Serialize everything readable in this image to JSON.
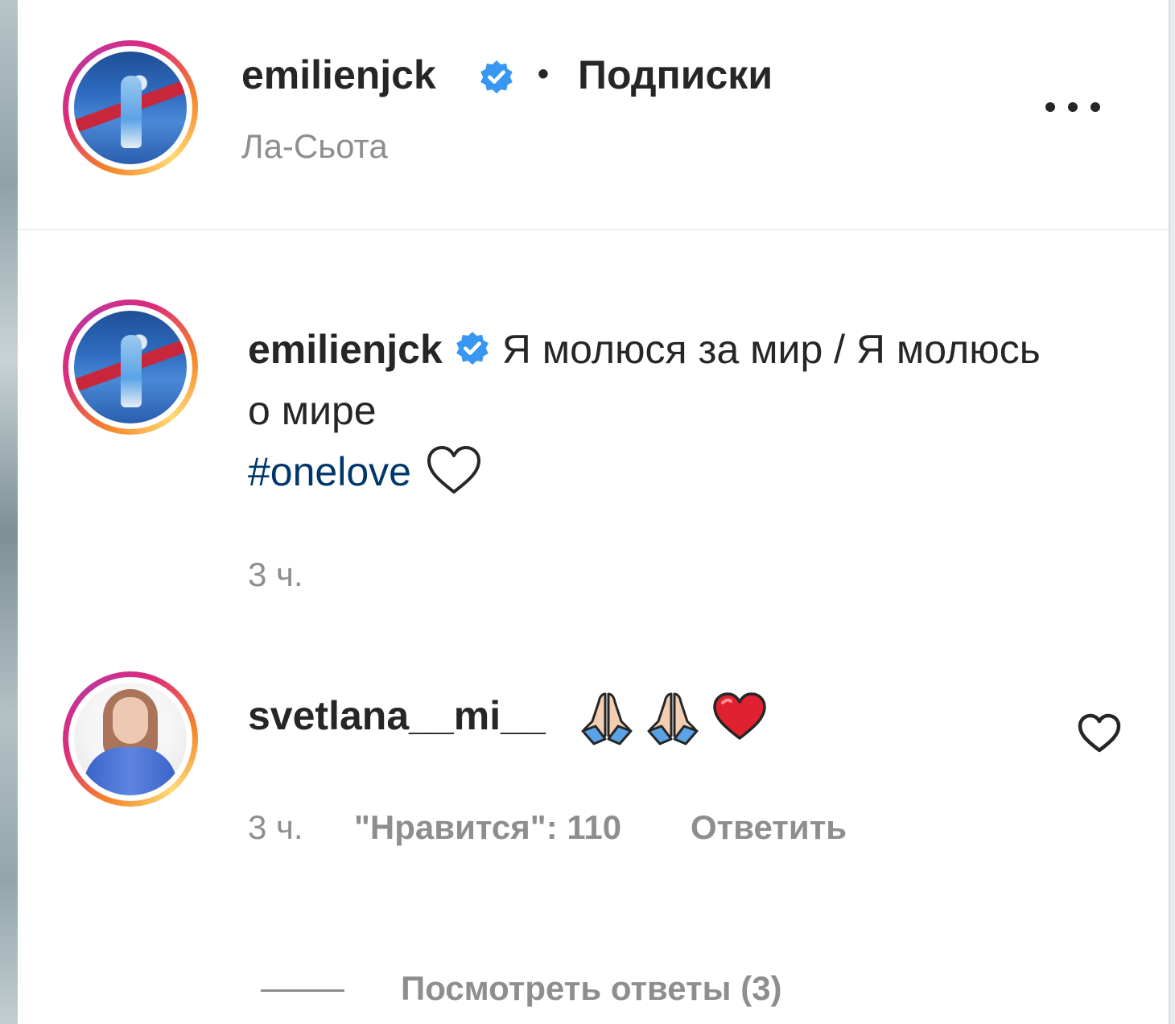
{
  "header": {
    "username": "emilienjck",
    "bullet": "•",
    "follow_label": "Подписки",
    "location": "Ла-Сьота"
  },
  "caption": {
    "username": "emilienjck",
    "text": "Я молюся за мир / Я молюсь о мире",
    "hashtag": "#onelove",
    "time": "3 ч."
  },
  "comment": {
    "username": "svetlana__mi__",
    "time": "3 ч.",
    "likes": "\"Нравится\": 110",
    "reply_label": "Ответить",
    "view_replies": "Посмотреть ответы (3)"
  },
  "colors": {
    "verified_badge": "#3897f0",
    "hashtag": "#00376b",
    "secondary_text": "#8e8e8e",
    "heart_emoji": "#e0212f"
  },
  "icons": [
    "verified-badge-icon",
    "more-options-icon",
    "white-heart-icon",
    "pray-hands-icon",
    "red-heart-icon",
    "like-heart-icon"
  ]
}
